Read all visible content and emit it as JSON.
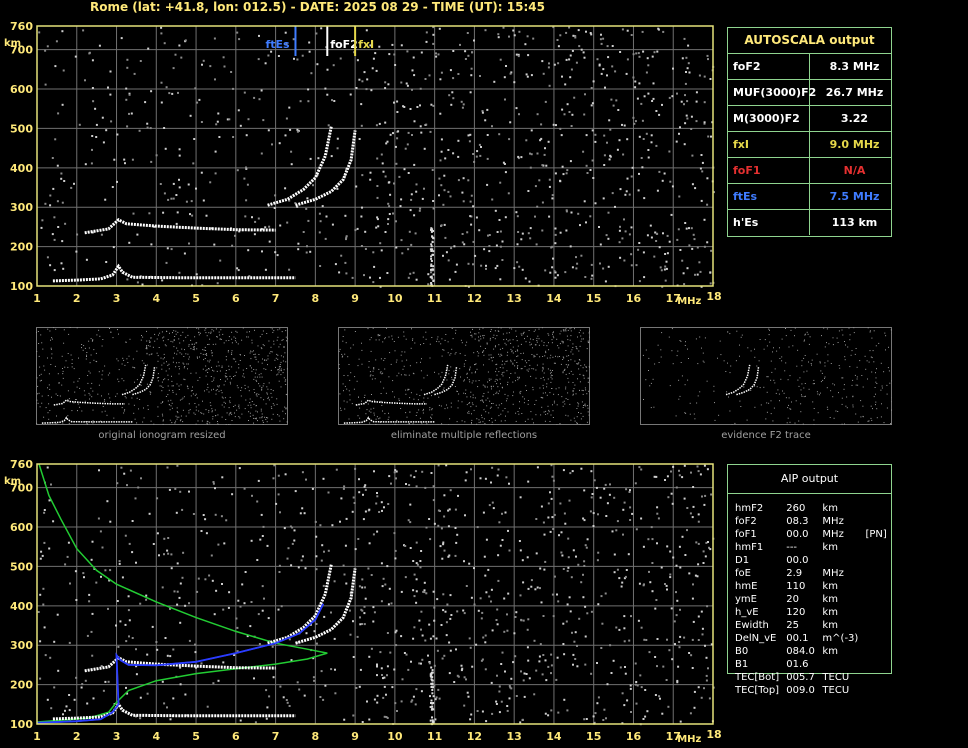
{
  "header": "Rome (lat: +41.8, lon: 012.5) - DATE: 2025 08 29 - TIME (UT): 15:45",
  "colors": {
    "grid": "#707070",
    "axis": "#e6e27a",
    "trace": "#ffffff",
    "blue": "#2a3cff",
    "green": "#22cc33",
    "fxI": "#e6d84a",
    "ftEs": "#3f7cff",
    "foF1": "#e53030"
  },
  "autoscala": {
    "title": "AUTOSCALA output",
    "rows": [
      {
        "key": "foF2",
        "value": "8.3 MHz",
        "color": "#ffffff"
      },
      {
        "key": "MUF(3000)F2",
        "value": "26.7 MHz",
        "color": "#ffffff"
      },
      {
        "key": "M(3000)F2",
        "value": "3.22",
        "color": "#ffffff"
      },
      {
        "key": "fxI",
        "value": "9.0 MHz",
        "color": "#e6d84a"
      },
      {
        "key": "foF1",
        "value": "N/A",
        "color": "#e53030"
      },
      {
        "key": "ftEs",
        "value": "7.5 MHz",
        "color": "#3f7cff"
      },
      {
        "key": "h'Es",
        "value": "113    km",
        "color": "#ffffff"
      }
    ]
  },
  "aip": {
    "title": "AIP output",
    "rows": [
      [
        "hmF2",
        "260",
        "km",
        ""
      ],
      [
        "foF2",
        "08.3",
        "MHz",
        ""
      ],
      [
        "foF1",
        "00.0",
        "MHz",
        "[PN]"
      ],
      [
        "hmF1",
        "---",
        "km",
        ""
      ],
      [
        "D1",
        "00.0",
        "",
        ""
      ],
      [
        "foE",
        "2.9",
        "MHz",
        ""
      ],
      [
        "hmE",
        "110",
        "km",
        ""
      ],
      [
        "ymE",
        "20",
        "km",
        ""
      ],
      [
        "h_vE",
        "120",
        "km",
        ""
      ],
      [
        "Ewidth",
        "25",
        "km",
        ""
      ],
      [
        "DelN_vE",
        "00.1",
        "m^(-3)",
        ""
      ],
      [
        "B0",
        "084.0",
        "km",
        ""
      ],
      [
        "B1",
        "01.6",
        "",
        ""
      ],
      [
        "TEC[Bot]",
        "005.7",
        "TECU",
        ""
      ],
      [
        "TEC[Top]",
        "009.0",
        "TECU",
        ""
      ]
    ]
  },
  "thumbnails": [
    "original ionogram resized",
    "eliminate multiple reflections",
    "evidence F2 trace"
  ],
  "chart_data": [
    {
      "type": "scatter",
      "xlabel": "MHz",
      "ylabel": "km",
      "xlim": [
        1,
        18
      ],
      "ylim": [
        100,
        760
      ],
      "x_ticks": [
        1,
        2,
        3,
        4,
        5,
        6,
        7,
        8,
        9,
        10,
        11,
        12,
        13,
        14,
        15,
        16,
        17,
        18
      ],
      "y_ticks": [
        100,
        200,
        300,
        400,
        500,
        600,
        700,
        760
      ],
      "markers": [
        {
          "label": "ftEs",
          "x": 7.5,
          "color": "#3f7cff"
        },
        {
          "label": "foF2",
          "x": 8.3,
          "color": "#ffffff"
        },
        {
          "label": "fxI",
          "x": 9.0,
          "color": "#e6d84a"
        }
      ],
      "series": [
        {
          "values": [
            [
              1.4,
              113
            ],
            [
              2.0,
              115
            ],
            [
              2.6,
              118
            ],
            [
              2.9,
              128
            ],
            [
              3.05,
              150
            ],
            [
              3.15,
              135
            ],
            [
              3.4,
              122
            ],
            [
              4.5,
              121
            ],
            [
              6.0,
              121
            ],
            [
              7.5,
              121
            ]
          ]
        },
        {
          "values": [
            [
              2.2,
              235
            ],
            [
              2.8,
              245
            ],
            [
              3.05,
              268
            ],
            [
              3.25,
              258
            ],
            [
              4.0,
              252
            ],
            [
              5.0,
              247
            ],
            [
              6.0,
              243
            ],
            [
              7.0,
              242
            ]
          ]
        },
        {
          "values": [
            [
              6.8,
              305
            ],
            [
              7.3,
              320
            ],
            [
              7.7,
              345
            ],
            [
              8.0,
              375
            ],
            [
              8.25,
              430
            ],
            [
              8.4,
              505
            ]
          ]
        },
        {
          "values": [
            [
              7.5,
              305
            ],
            [
              8.0,
              320
            ],
            [
              8.4,
              340
            ],
            [
              8.7,
              370
            ],
            [
              8.9,
              420
            ],
            [
              9.0,
              495
            ]
          ]
        }
      ]
    },
    {
      "type": "line",
      "xlabel": "MHz",
      "ylabel": "km",
      "xlim": [
        1,
        18
      ],
      "ylim": [
        100,
        760
      ],
      "x_ticks": [
        1,
        2,
        3,
        4,
        5,
        6,
        7,
        8,
        9,
        10,
        11,
        12,
        13,
        14,
        15,
        16,
        17,
        18
      ],
      "y_ticks": [
        100,
        200,
        300,
        400,
        500,
        600,
        700,
        760
      ],
      "series": [
        {
          "color": "#22cc33",
          "values": [
            [
              1.05,
              760
            ],
            [
              1.3,
              680
            ],
            [
              1.6,
              620
            ],
            [
              2.0,
              545
            ],
            [
              2.5,
              490
            ],
            [
              3.0,
              455
            ],
            [
              4.0,
              410
            ],
            [
              5.0,
              370
            ],
            [
              6.0,
              335
            ],
            [
              7.0,
              305
            ],
            [
              7.8,
              290
            ],
            [
              8.3,
              280
            ],
            [
              7.8,
              265
            ],
            [
              7.0,
              252
            ],
            [
              6.0,
              240
            ],
            [
              5.0,
              228
            ],
            [
              4.0,
              210
            ],
            [
              3.3,
              185
            ],
            [
              3.0,
              155
            ],
            [
              2.8,
              130
            ],
            [
              2.3,
              115
            ],
            [
              1.0,
              105
            ]
          ]
        },
        {
          "color": "#2a3cff",
          "values": [
            [
              1.0,
              103
            ],
            [
              2.0,
              107
            ],
            [
              2.6,
              112
            ],
            [
              2.9,
              130
            ],
            [
              3.05,
              150
            ],
            [
              3.0,
              275
            ],
            [
              3.1,
              262
            ],
            [
              3.3,
              250
            ],
            [
              4.0,
              249
            ],
            [
              5.0,
              258
            ],
            [
              6.0,
              280
            ],
            [
              7.0,
              305
            ],
            [
              7.6,
              330
            ],
            [
              8.0,
              365
            ],
            [
              8.2,
              405
            ]
          ]
        }
      ]
    }
  ]
}
